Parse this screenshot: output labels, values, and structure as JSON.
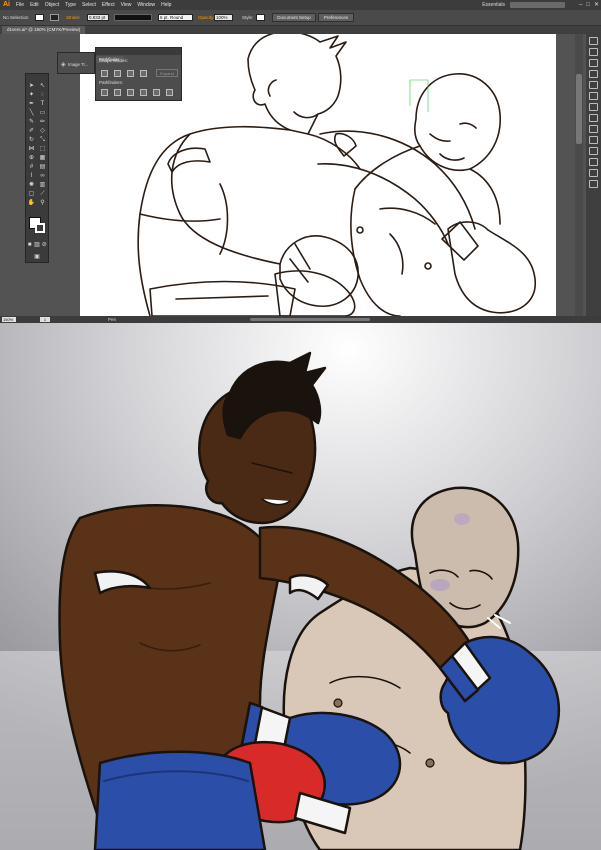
{
  "app": {
    "logo": "Ai",
    "menu": [
      "File",
      "Edit",
      "Object",
      "Type",
      "Select",
      "Effect",
      "View",
      "Window",
      "Help"
    ],
    "workspace": "Essentials",
    "window_buttons": [
      "–",
      "□",
      "✕"
    ]
  },
  "controlbar": {
    "selection_label": "No Selection",
    "stroke_label": "Stroke:",
    "stroke_value": "0.833 pt",
    "brush_label": "6 pt. Round",
    "opacity_label": "Opacity:",
    "opacity_value": "100%",
    "style_label": "Style:",
    "doc_setup": "Document Setup",
    "preferences": "Preferences"
  },
  "document": {
    "tab_label": "d1vers.ai* @ 150% (CMYK/Preview)"
  },
  "panels": {
    "image_trace": "Image Tr...",
    "pathfinder": {
      "title": "Pathfinder",
      "shape_modes": "Shape Modes:",
      "pathfinders": "Pathfinders:",
      "expand": "Expand"
    }
  },
  "statusbar": {
    "zoom": "150%",
    "page": "1",
    "tool": "Pen"
  },
  "colors": {
    "accent": "#ff9a00",
    "ui_dark": "#3c3c3c",
    "ui_mid": "#535353",
    "dark_skin": "#5a3218",
    "light_skin": "#d9c8b8",
    "glove_blue": "#2b4ea8",
    "glove_red": "#d92a2a",
    "trunks_blue": "#2b4ea8"
  },
  "icons": [
    "ai-logo-icon",
    "search-icon",
    "selection-tool-icon",
    "pen-tool-icon",
    "type-tool-icon",
    "zoom-tool-icon",
    "hand-tool-icon",
    "shape-mode-unite-icon",
    "shape-mode-minus-front-icon",
    "shape-mode-intersect-icon",
    "shape-mode-exclude-icon"
  ]
}
